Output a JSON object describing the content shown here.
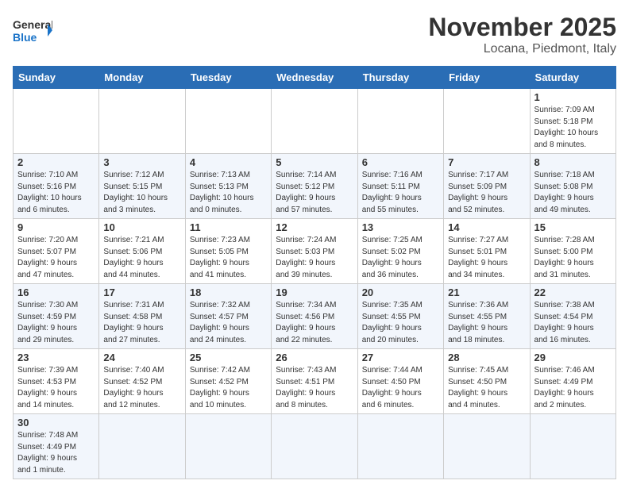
{
  "header": {
    "logo_general": "General",
    "logo_blue": "Blue",
    "month": "November 2025",
    "location": "Locana, Piedmont, Italy"
  },
  "weekdays": [
    "Sunday",
    "Monday",
    "Tuesday",
    "Wednesday",
    "Thursday",
    "Friday",
    "Saturday"
  ],
  "weeks": [
    [
      {
        "day": "",
        "info": ""
      },
      {
        "day": "",
        "info": ""
      },
      {
        "day": "",
        "info": ""
      },
      {
        "day": "",
        "info": ""
      },
      {
        "day": "",
        "info": ""
      },
      {
        "day": "",
        "info": ""
      },
      {
        "day": "1",
        "info": "Sunrise: 7:09 AM\nSunset: 5:18 PM\nDaylight: 10 hours\nand 8 minutes."
      }
    ],
    [
      {
        "day": "2",
        "info": "Sunrise: 7:10 AM\nSunset: 5:16 PM\nDaylight: 10 hours\nand 6 minutes."
      },
      {
        "day": "3",
        "info": "Sunrise: 7:12 AM\nSunset: 5:15 PM\nDaylight: 10 hours\nand 3 minutes."
      },
      {
        "day": "4",
        "info": "Sunrise: 7:13 AM\nSunset: 5:13 PM\nDaylight: 10 hours\nand 0 minutes."
      },
      {
        "day": "5",
        "info": "Sunrise: 7:14 AM\nSunset: 5:12 PM\nDaylight: 9 hours\nand 57 minutes."
      },
      {
        "day": "6",
        "info": "Sunrise: 7:16 AM\nSunset: 5:11 PM\nDaylight: 9 hours\nand 55 minutes."
      },
      {
        "day": "7",
        "info": "Sunrise: 7:17 AM\nSunset: 5:09 PM\nDaylight: 9 hours\nand 52 minutes."
      },
      {
        "day": "8",
        "info": "Sunrise: 7:18 AM\nSunset: 5:08 PM\nDaylight: 9 hours\nand 49 minutes."
      }
    ],
    [
      {
        "day": "9",
        "info": "Sunrise: 7:20 AM\nSunset: 5:07 PM\nDaylight: 9 hours\nand 47 minutes."
      },
      {
        "day": "10",
        "info": "Sunrise: 7:21 AM\nSunset: 5:06 PM\nDaylight: 9 hours\nand 44 minutes."
      },
      {
        "day": "11",
        "info": "Sunrise: 7:23 AM\nSunset: 5:05 PM\nDaylight: 9 hours\nand 41 minutes."
      },
      {
        "day": "12",
        "info": "Sunrise: 7:24 AM\nSunset: 5:03 PM\nDaylight: 9 hours\nand 39 minutes."
      },
      {
        "day": "13",
        "info": "Sunrise: 7:25 AM\nSunset: 5:02 PM\nDaylight: 9 hours\nand 36 minutes."
      },
      {
        "day": "14",
        "info": "Sunrise: 7:27 AM\nSunset: 5:01 PM\nDaylight: 9 hours\nand 34 minutes."
      },
      {
        "day": "15",
        "info": "Sunrise: 7:28 AM\nSunset: 5:00 PM\nDaylight: 9 hours\nand 31 minutes."
      }
    ],
    [
      {
        "day": "16",
        "info": "Sunrise: 7:30 AM\nSunset: 4:59 PM\nDaylight: 9 hours\nand 29 minutes."
      },
      {
        "day": "17",
        "info": "Sunrise: 7:31 AM\nSunset: 4:58 PM\nDaylight: 9 hours\nand 27 minutes."
      },
      {
        "day": "18",
        "info": "Sunrise: 7:32 AM\nSunset: 4:57 PM\nDaylight: 9 hours\nand 24 minutes."
      },
      {
        "day": "19",
        "info": "Sunrise: 7:34 AM\nSunset: 4:56 PM\nDaylight: 9 hours\nand 22 minutes."
      },
      {
        "day": "20",
        "info": "Sunrise: 7:35 AM\nSunset: 4:55 PM\nDaylight: 9 hours\nand 20 minutes."
      },
      {
        "day": "21",
        "info": "Sunrise: 7:36 AM\nSunset: 4:55 PM\nDaylight: 9 hours\nand 18 minutes."
      },
      {
        "day": "22",
        "info": "Sunrise: 7:38 AM\nSunset: 4:54 PM\nDaylight: 9 hours\nand 16 minutes."
      }
    ],
    [
      {
        "day": "23",
        "info": "Sunrise: 7:39 AM\nSunset: 4:53 PM\nDaylight: 9 hours\nand 14 minutes."
      },
      {
        "day": "24",
        "info": "Sunrise: 7:40 AM\nSunset: 4:52 PM\nDaylight: 9 hours\nand 12 minutes."
      },
      {
        "day": "25",
        "info": "Sunrise: 7:42 AM\nSunset: 4:52 PM\nDaylight: 9 hours\nand 10 minutes."
      },
      {
        "day": "26",
        "info": "Sunrise: 7:43 AM\nSunset: 4:51 PM\nDaylight: 9 hours\nand 8 minutes."
      },
      {
        "day": "27",
        "info": "Sunrise: 7:44 AM\nSunset: 4:50 PM\nDaylight: 9 hours\nand 6 minutes."
      },
      {
        "day": "28",
        "info": "Sunrise: 7:45 AM\nSunset: 4:50 PM\nDaylight: 9 hours\nand 4 minutes."
      },
      {
        "day": "29",
        "info": "Sunrise: 7:46 AM\nSunset: 4:49 PM\nDaylight: 9 hours\nand 2 minutes."
      }
    ],
    [
      {
        "day": "30",
        "info": "Sunrise: 7:48 AM\nSunset: 4:49 PM\nDaylight: 9 hours\nand 1 minute."
      },
      {
        "day": "",
        "info": ""
      },
      {
        "day": "",
        "info": ""
      },
      {
        "day": "",
        "info": ""
      },
      {
        "day": "",
        "info": ""
      },
      {
        "day": "",
        "info": ""
      },
      {
        "day": "",
        "info": ""
      }
    ]
  ]
}
